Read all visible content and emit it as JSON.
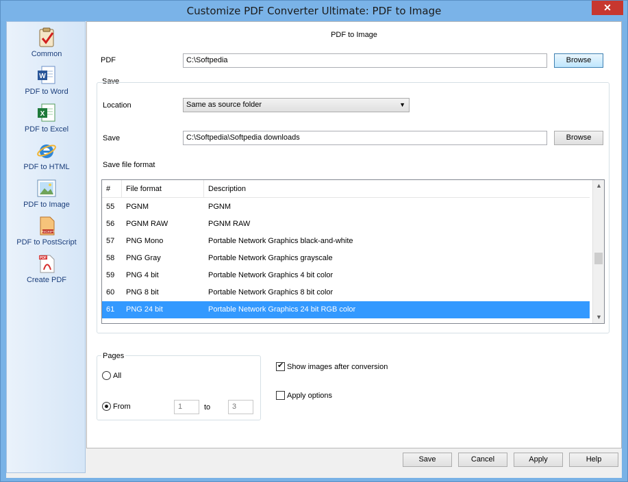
{
  "window": {
    "title": "Customize PDF Converter Ultimate: PDF to Image"
  },
  "sidebar": {
    "items": [
      {
        "label": "Common",
        "icon": "clipboard-check-icon"
      },
      {
        "label": "PDF to Word",
        "icon": "word-document-icon"
      },
      {
        "label": "PDF to Excel",
        "icon": "excel-document-icon"
      },
      {
        "label": "PDF to HTML",
        "icon": "internet-explorer-icon"
      },
      {
        "label": "PDF to Image",
        "icon": "image-icon"
      },
      {
        "label": "PDF to PostScript",
        "icon": "postscript-document-icon"
      },
      {
        "label": "Create PDF",
        "icon": "pdf-document-icon"
      }
    ],
    "active": "PDF to Image"
  },
  "main": {
    "heading": "PDF to Image",
    "pdf": {
      "label": "PDF",
      "value": "C:\\Softpedia",
      "browse_label": "Browse"
    },
    "save_group": {
      "title": "Save",
      "location_label": "Location",
      "location_value": "Same as source folder",
      "save_label": "Save",
      "save_value": "C:\\Softpedia\\Softpedia downloads",
      "browse_label": "Browse",
      "format_label": "Save file format"
    },
    "format_list": {
      "columns": [
        "#",
        "File format",
        "Description"
      ],
      "rows": [
        {
          "num": "55",
          "format": "PGNM",
          "description": "PGNM"
        },
        {
          "num": "56",
          "format": "PGNM RAW",
          "description": "PGNM RAW"
        },
        {
          "num": "57",
          "format": "PNG Mono",
          "description": "Portable Network Graphics black-and-white"
        },
        {
          "num": "58",
          "format": "PNG Gray",
          "description": "Portable Network Graphics grayscale"
        },
        {
          "num": "59",
          "format": "PNG 4 bit",
          "description": "Portable Network Graphics 4 bit color"
        },
        {
          "num": "60",
          "format": "PNG 8 bit",
          "description": "Portable Network Graphics 8 bit color"
        },
        {
          "num": "61",
          "format": "PNG 24 bit",
          "description": "Portable Network Graphics 24 bit RGB color"
        }
      ],
      "selected_num": "61"
    },
    "pages": {
      "title": "Pages",
      "all_label": "All",
      "from_label": "From",
      "to_label": "to",
      "from_value": "1",
      "to_value": "3",
      "selected": "From"
    },
    "show_images": {
      "label": "Show images after conversion",
      "checked": true
    },
    "apply_options": {
      "label": "Apply options",
      "checked": false
    }
  },
  "footer": {
    "save_label": "Save",
    "cancel_label": "Cancel",
    "apply_label": "Apply",
    "help_label": "Help"
  },
  "colors": {
    "accent": "#3399ff",
    "titlebar": "#7ab3e8",
    "close": "#c7372f"
  }
}
